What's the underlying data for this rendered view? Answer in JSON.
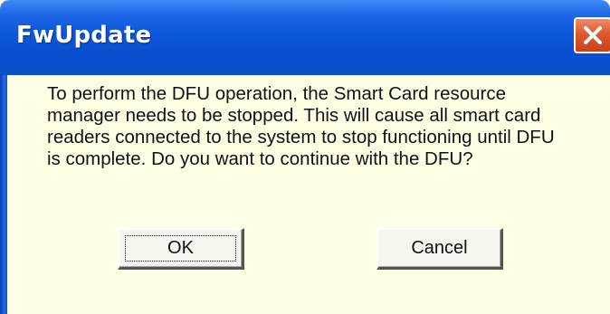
{
  "window": {
    "title": "FwUpdate"
  },
  "dialog": {
    "message_lines": [
      "To perform the DFU operation, the Smart Card resource",
      "manager needs to be stopped. This will cause all smart card",
      "readers connected to the system to stop functioning until DFU",
      "is complete. Do you want to continue with the DFU?"
    ],
    "ok_label": "OK",
    "cancel_label": "Cancel"
  },
  "icons": {
    "close": "close-icon"
  },
  "colors": {
    "titlebar": "#0b56d8",
    "dialog_background": "#ffffe6",
    "close_button": "#e0582e"
  }
}
